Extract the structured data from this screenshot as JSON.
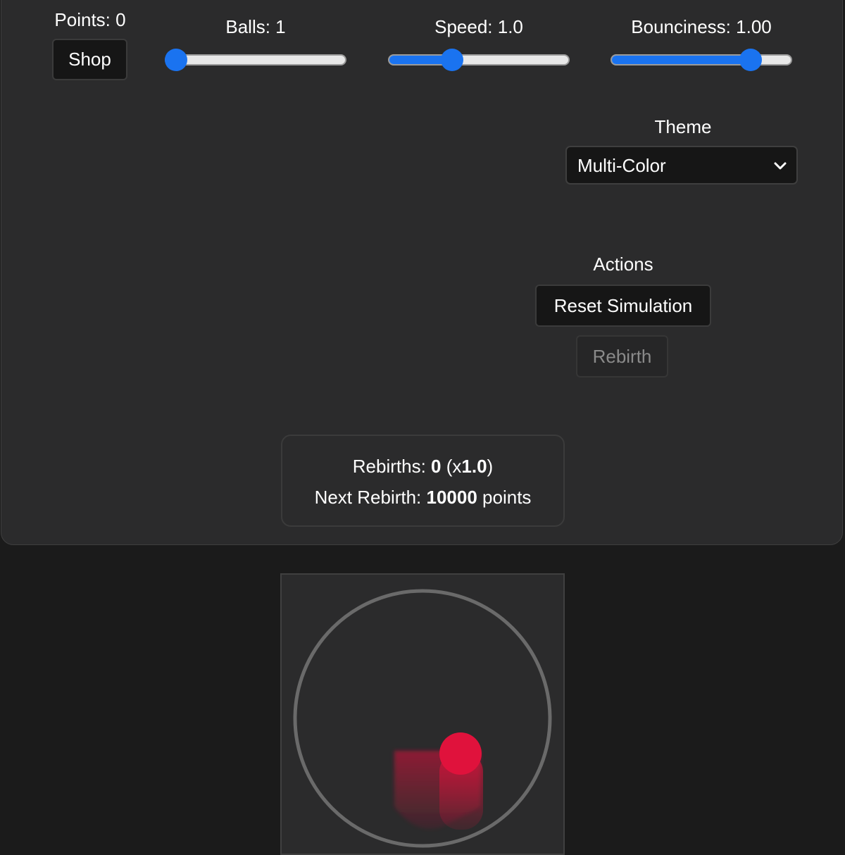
{
  "header": {
    "points_label": "Points: 0",
    "shop_label": "Shop"
  },
  "sliders": {
    "balls": {
      "label": "Balls: 1",
      "fraction": 0.0
    },
    "speed": {
      "label": "Speed: 1.0",
      "fraction": 0.33
    },
    "bounciness": {
      "label": "Bounciness: 1.00",
      "fraction": 0.81
    }
  },
  "theme": {
    "heading": "Theme",
    "selected": "Multi-Color"
  },
  "actions": {
    "heading": "Actions",
    "reset_label": "Reset Simulation",
    "rebirth_label": "Rebirth"
  },
  "rebirth_info": {
    "rebirths_prefix": "Rebirths: ",
    "rebirths_count": "0",
    "multiplier_open": " (x",
    "multiplier_value": "1.0",
    "multiplier_close": ")",
    "next_prefix": "Next Rebirth: ",
    "next_value": "10000",
    "next_suffix": " points"
  },
  "colors": {
    "accent": "#1a73f0",
    "ball": "#e0123c",
    "ring": "#6a6a6a",
    "panel": "#2b2b2c",
    "page": "#1b1b1b"
  }
}
